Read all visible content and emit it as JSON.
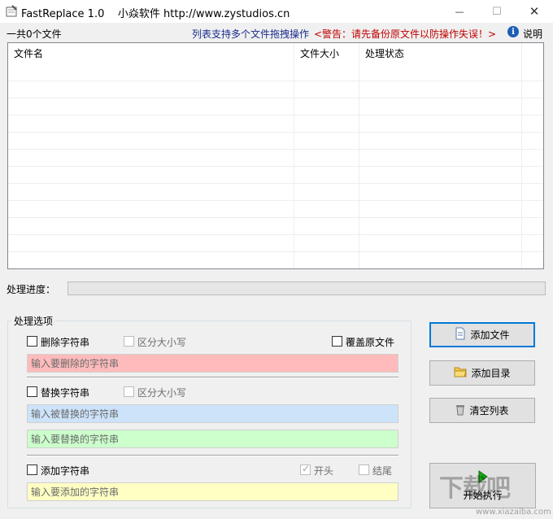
{
  "window": {
    "title": "FastReplace 1.0    小焱软件 http://www.zystudios.cn",
    "minimize_glyph": "—",
    "maximize_glyph": "☐",
    "close_glyph": "✕"
  },
  "header": {
    "file_count": "一共0个文件",
    "drag_tip": "列表支持多个文件拖拽操作",
    "warning": "<警告：请先备份原文件以防操作失误！>",
    "help_label": "说明",
    "info_glyph": "i"
  },
  "file_list": {
    "columns": [
      "文件名",
      "文件大小",
      "处理状态"
    ],
    "rows": []
  },
  "progress": {
    "label": "处理进度：",
    "value": 0
  },
  "options": {
    "group_title": "处理选项",
    "delete": {
      "label": "删除字符串",
      "checked": false,
      "case_label": "区分大小写",
      "placeholder": "输入要删除的字符串",
      "color": "#ffbbbb"
    },
    "overwrite_label": "覆盖原文件",
    "replace": {
      "label": "替换字符串",
      "checked": false,
      "case_label": "区分大小写",
      "find_placeholder": "输入被替换的字符串",
      "find_color": "#cce3fa",
      "replace_placeholder": "输入要替换的字符串",
      "replace_color": "#ccffcc"
    },
    "add": {
      "label": "添加字符串",
      "checked": false,
      "start_label": "开头",
      "start_checked": true,
      "end_label": "结尾",
      "end_checked": false,
      "placeholder": "输入要添加的字符串",
      "color": "#ffffc4"
    }
  },
  "buttons": {
    "add_file": "添加文件",
    "add_folder": "添加目录",
    "clear_list": "清空列表",
    "start": "开始执行"
  },
  "watermark": {
    "text": "下载吧",
    "url": "www.xiazaiba.com"
  }
}
